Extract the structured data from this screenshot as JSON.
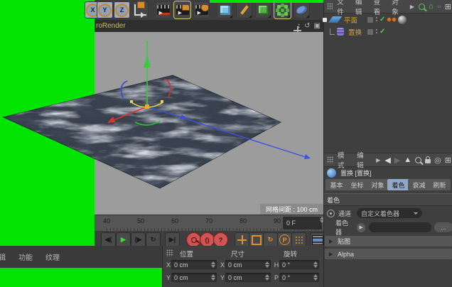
{
  "colors": {
    "chroma_green": "#00e400",
    "viewport_grey": "#9c9c9c",
    "panel_grey": "#404040",
    "accent_orange": "#e09030",
    "object_label_orange": "#d2a040",
    "active_tab_blue": "#8fa8c8",
    "axis_x_red": "#e03232",
    "axis_y_green": "#3cc83c",
    "axis_z_blue": "#3c50e0"
  },
  "top_toolbar": {
    "axis_lock_buttons": [
      "X",
      "Y",
      "Z"
    ]
  },
  "viewport": {
    "title": "roRender",
    "grid_spacing_label": "网格间距 : 100 cm"
  },
  "timeline": {
    "ticks": [
      "40",
      "50",
      "60",
      "70",
      "80",
      "90"
    ],
    "current_frame": "0 F"
  },
  "transport": {
    "prev_key_glyph": "◀(",
    "play_glyph": "▶",
    "next_key_glyph": "(▶",
    "loop_glyph": "↻",
    "goto_end_glyph": "▶|",
    "parens_glyph": "()",
    "question_glyph": "?",
    "rotate_glyph": "↻",
    "param_label": "P"
  },
  "bottom_menu": {
    "items": [
      "编辑",
      "功能",
      "纹理"
    ]
  },
  "coordinates": {
    "position_title": "位置",
    "size_title": "尺寸",
    "rotation_title": "旋转",
    "rows": [
      {
        "a1": "X",
        "v1": "0 cm",
        "a2": "X",
        "v2": "0 cm",
        "a3": "H",
        "v3": "0 °"
      },
      {
        "a1": "Y",
        "v1": "0 cm",
        "a2": "Y",
        "v2": "0 cm",
        "a3": "P",
        "v3": "0 °"
      }
    ]
  },
  "object_manager": {
    "menu": [
      "文件",
      "编辑",
      "查看",
      "对象"
    ],
    "objects": [
      {
        "label": "平面"
      },
      {
        "label": "置换"
      }
    ]
  },
  "attribute_manager": {
    "menu": [
      "模式",
      "编辑"
    ],
    "object_title": "置换 [置换]",
    "tabs": [
      "基本",
      "坐标",
      "对象",
      "着色",
      "衰减",
      "刷新"
    ],
    "active_tab": "着色",
    "shading_section": "着色",
    "channel_label": "通道",
    "channel_value": "自定义着色器",
    "shader_label": "着色器",
    "browse_label": "...",
    "sections": [
      "贴图",
      "Alpha"
    ]
  }
}
